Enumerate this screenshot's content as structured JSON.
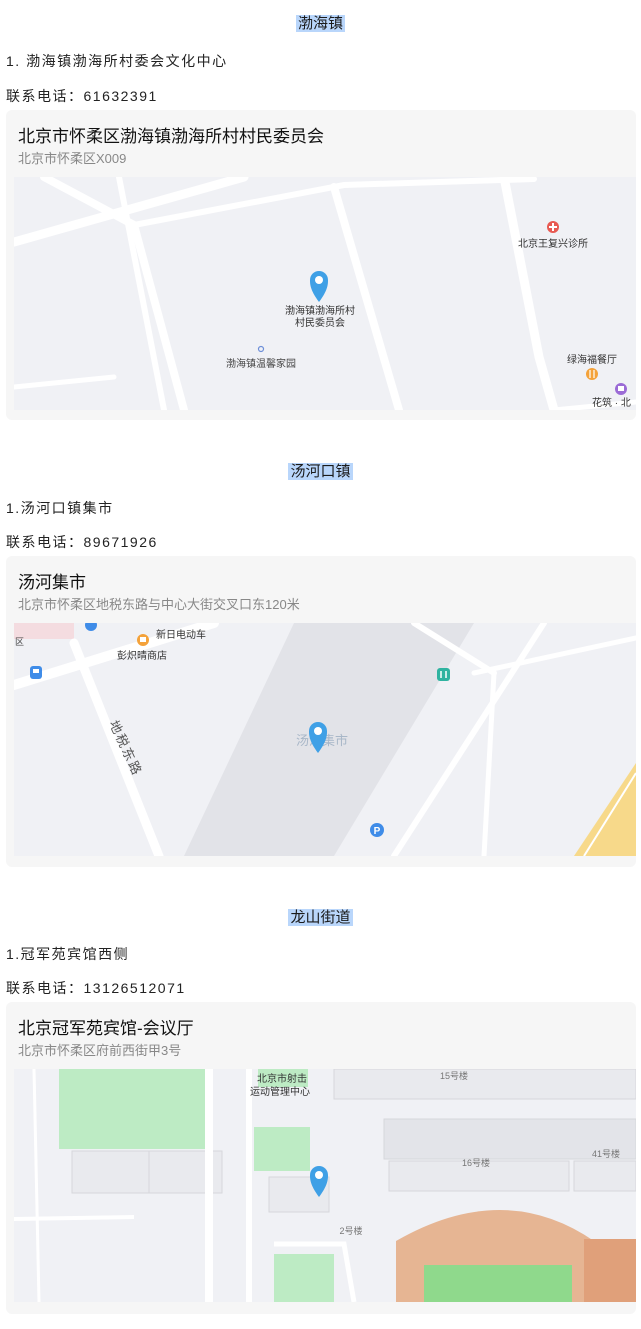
{
  "sections": [
    {
      "title": "渤海镇",
      "item": "1. 渤海镇渤海所村委会文化中心",
      "phone": "联系电话：61632391",
      "card": {
        "name": "北京市怀柔区渤海镇渤海所村村民委员会",
        "address": "北京市怀柔区X009",
        "map_labels": {
          "poi_main_1": "渤海镇渤海所村",
          "poi_main_2": "村民委员会",
          "clinic": "北京王复兴诊所",
          "garden": "渤海镇温馨家园",
          "restaurant": "绿海福餐厅",
          "flower": "花筑 · 北"
        }
      }
    },
    {
      "title": "汤河口镇",
      "item": "1.汤河口镇集市",
      "phone": "联系电话：89671926",
      "card": {
        "name": "汤河集市",
        "address": "北京市怀柔区地税东路与中心大街交叉口东120米",
        "map_labels": {
          "market": "汤河集市",
          "ev_store": "新日电动车",
          "shop": "彭炽晴商店",
          "road": "地税东路",
          "edge": "区"
        }
      }
    },
    {
      "title": "龙山街道",
      "item": "1.冠军苑宾馆西侧",
      "phone": "联系电话：13126512071",
      "card": {
        "name": "北京冠军苑宾馆-会议厅",
        "address": "北京市怀柔区府前西街甲3号",
        "map_labels": {
          "center_1": "北京市射击",
          "center_2": "运动管理中心",
          "b15": "15号楼",
          "b16": "16号楼",
          "b41": "41号楼",
          "b2": "2号楼"
        }
      }
    }
  ],
  "colors": {
    "title_highlight": "#b9d6fb",
    "pin": "#3fa0e6",
    "map_bg": "#f0f1f5",
    "road": "#ffffff",
    "block": "#e3e4e9",
    "green": "#bdebc4",
    "track": "#e6b593",
    "clinic": "#e85a52",
    "restaurant": "#f4a23a",
    "parking": "#3f8ce8"
  }
}
